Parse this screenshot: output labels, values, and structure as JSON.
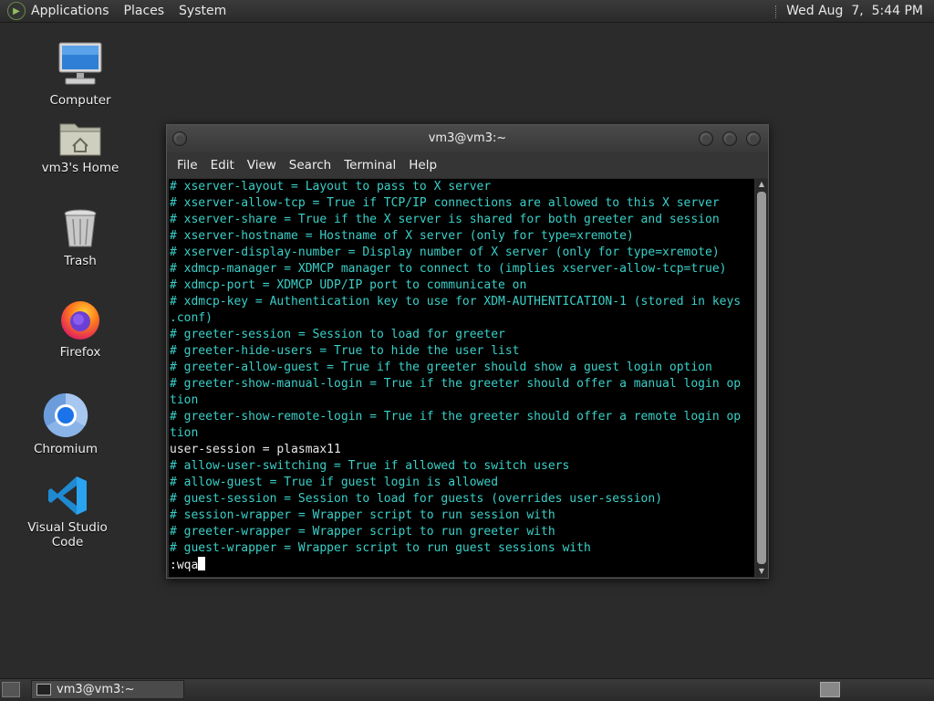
{
  "top_panel": {
    "menus": [
      "Applications",
      "Places",
      "System"
    ],
    "clock": "Wed Aug  7,  5:44 PM"
  },
  "desktop_icons": [
    {
      "label": "Computer",
      "icon": "computer-icon"
    },
    {
      "label": "vm3's Home",
      "icon": "home-folder-icon"
    },
    {
      "label": "Trash",
      "icon": "trash-icon"
    },
    {
      "label": "Firefox",
      "icon": "firefox-icon"
    },
    {
      "label": "Chromium",
      "icon": "chromium-icon"
    },
    {
      "label": "Visual Studio Code",
      "icon": "vscode-icon"
    }
  ],
  "terminal": {
    "title": "vm3@vm3:~",
    "menus": [
      "File",
      "Edit",
      "View",
      "Search",
      "Terminal",
      "Help"
    ],
    "lines": [
      "# xserver-layout = Layout to pass to X server",
      "# xserver-allow-tcp = True if TCP/IP connections are allowed to this X server",
      "# xserver-share = True if the X server is shared for both greeter and session",
      "# xserver-hostname = Hostname of X server (only for type=xremote)",
      "# xserver-display-number = Display number of X server (only for type=xremote)",
      "# xdmcp-manager = XDMCP manager to connect to (implies xserver-allow-tcp=true)",
      "# xdmcp-port = XDMCP UDP/IP port to communicate on",
      "# xdmcp-key = Authentication key to use for XDM-AUTHENTICATION-1 (stored in keys",
      ".conf)",
      "# greeter-session = Session to load for greeter",
      "# greeter-hide-users = True to hide the user list",
      "# greeter-allow-guest = True if the greeter should show a guest login option",
      "# greeter-show-manual-login = True if the greeter should offer a manual login op",
      "tion",
      "# greeter-show-remote-login = True if the greeter should offer a remote login op",
      "tion",
      "user-session = plasmax11",
      "# allow-user-switching = True if allowed to switch users",
      "# allow-guest = True if guest login is allowed",
      "# guest-session = Session to load for guests (overrides user-session)",
      "# session-wrapper = Wrapper script to run session with",
      "# greeter-wrapper = Wrapper script to run greeter with",
      "# guest-wrapper = Wrapper script to run guest sessions with"
    ],
    "command": ":wqa"
  },
  "taskbar": {
    "task_label": "vm3@vm3:~"
  },
  "colors": {
    "comment_text": "#3ad0c8",
    "plain_text": "#e8e8e8",
    "terminal_bg": "#000000",
    "desktop_bg": "#2b2b2b"
  }
}
